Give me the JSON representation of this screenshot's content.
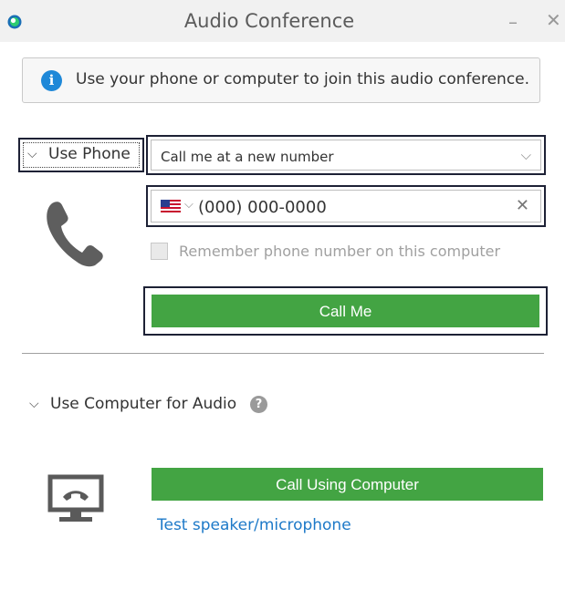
{
  "window": {
    "title": "Audio Conference",
    "minimize_glyph": "–",
    "close_glyph": "✕"
  },
  "info_banner": {
    "icon": "info-icon",
    "icon_glyph": "i",
    "text": "Use your phone or computer to join this audio conference."
  },
  "phone_section": {
    "header_label": "Use Phone",
    "expanded": true,
    "call_option_selected": "Call me at a new number",
    "country_flag": "US",
    "phone_placeholder": "(000) 000-0000",
    "phone_value": "",
    "remember_label": "Remember phone number on this computer",
    "remember_checked": false,
    "remember_enabled": false,
    "call_me_label": "Call Me"
  },
  "computer_section": {
    "header_label": "Use Computer for Audio",
    "help_glyph": "?",
    "call_button_label": "Call Using Computer",
    "test_link_label": "Test speaker/microphone"
  },
  "colors": {
    "accent_green": "#43a443",
    "link_blue": "#1d79c8",
    "info_blue": "#1e88d8",
    "focus_border": "#1d2135"
  }
}
